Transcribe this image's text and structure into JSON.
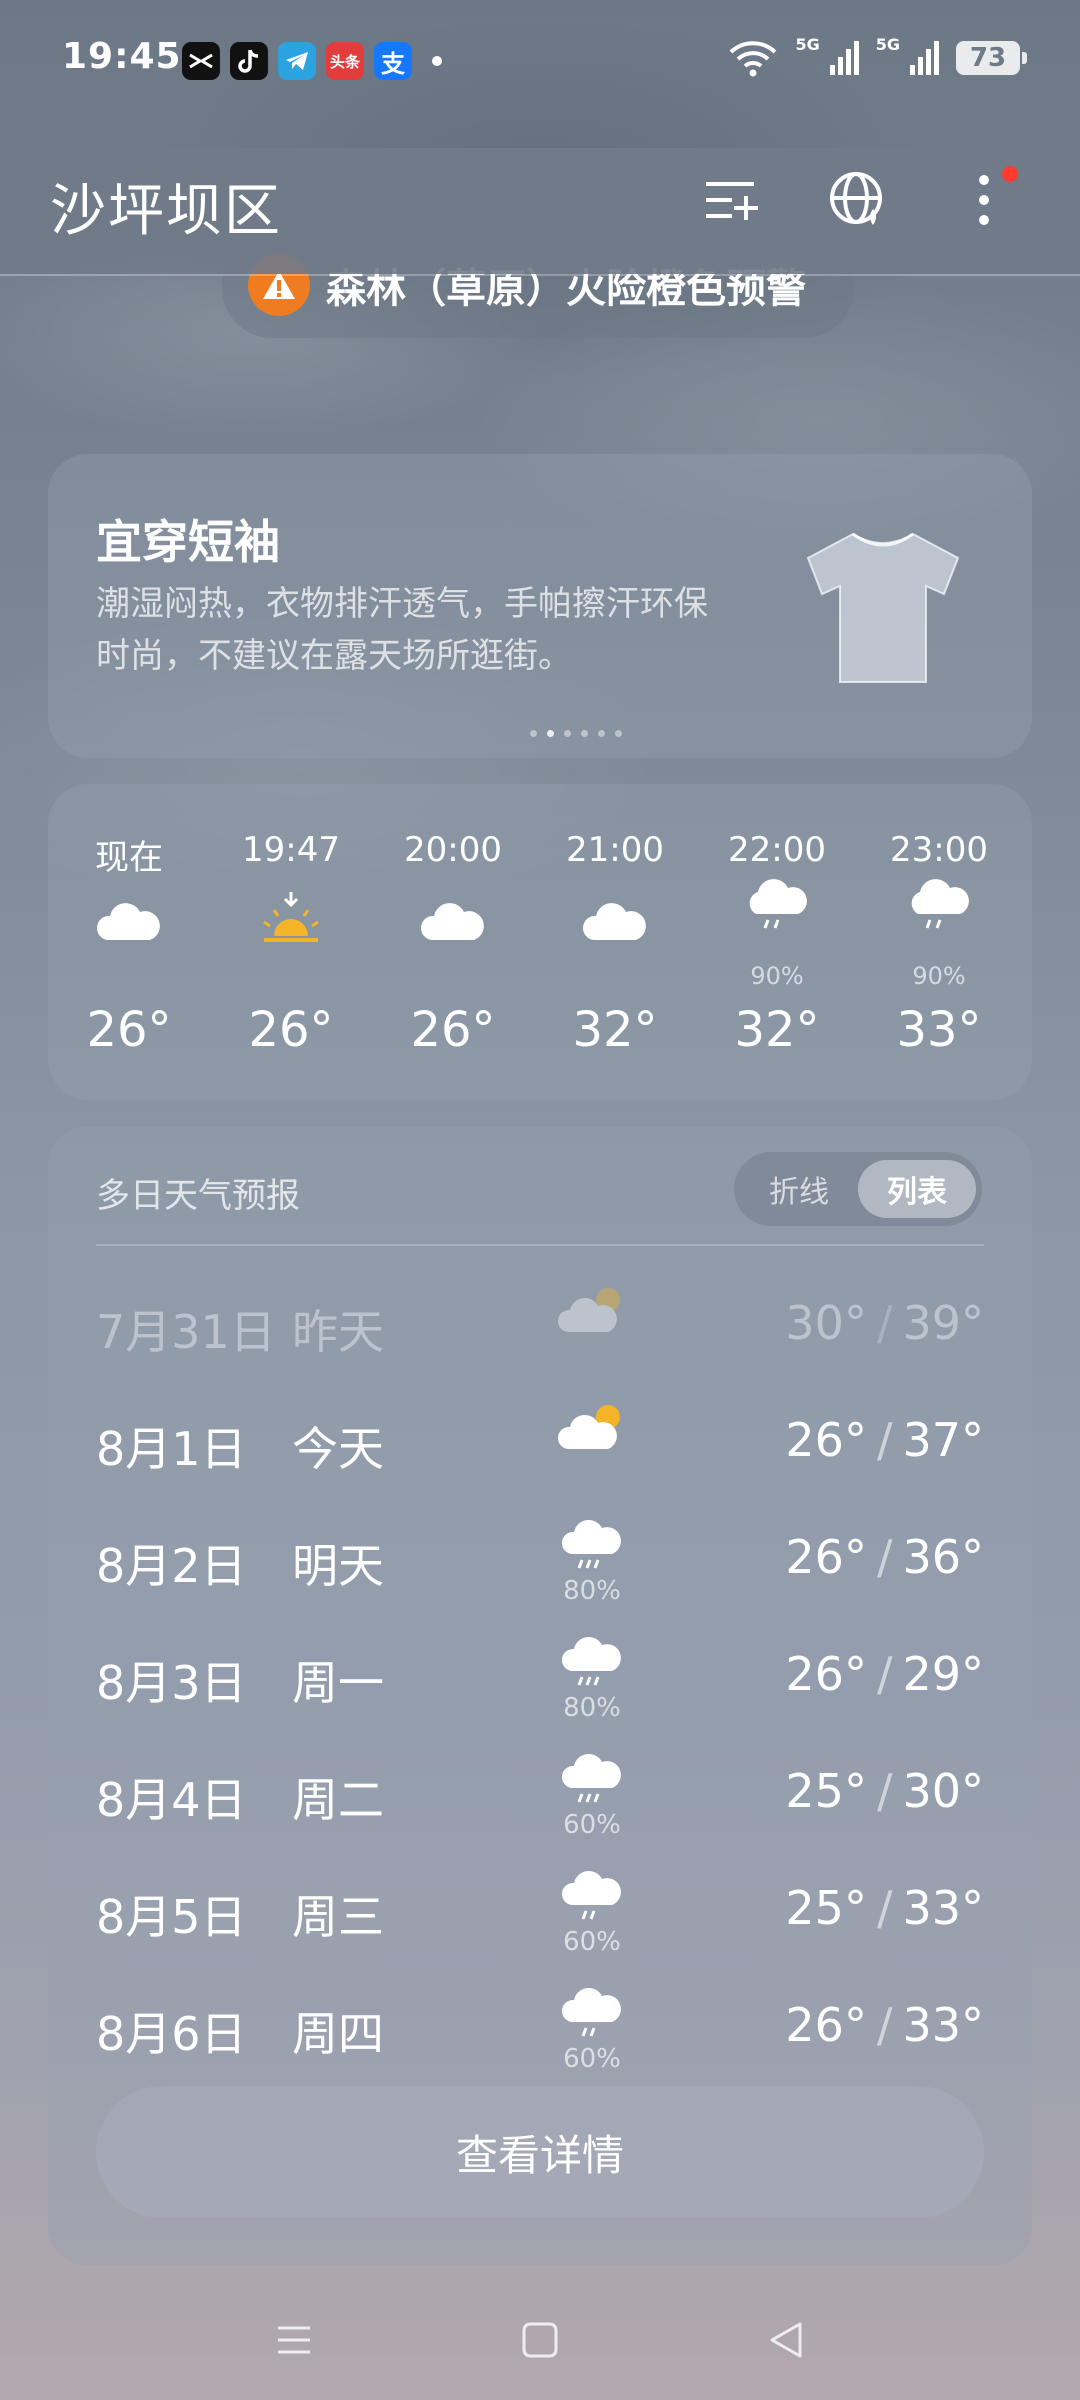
{
  "status_bar": {
    "time": "19:45",
    "apps": [
      {
        "icon": "capcut-icon",
        "label": "",
        "color": "#111111"
      },
      {
        "icon": "tiktok-icon",
        "label": "",
        "color": "#111111"
      },
      {
        "icon": "telegram-icon",
        "label": "",
        "color": "#2aa3e0"
      },
      {
        "icon": "toutiao-icon",
        "label": "头条",
        "color": "#e23c3c"
      },
      {
        "icon": "alipay-icon",
        "label": "支",
        "color": "#1677ff"
      }
    ],
    "network_1": "5G",
    "network_2": "5G",
    "battery": "73"
  },
  "header": {
    "location": "沙坪坝区"
  },
  "alert": {
    "text": "森林（草原）火险橙色预警",
    "color": "#f07c22"
  },
  "clothing": {
    "title": "宜穿短袖",
    "description": "潮湿闷热，衣物排汗透气，手帕擦汗环保时尚，不建议在露天场所逛街。",
    "page_count": 6,
    "active_page": 1
  },
  "hourly": [
    {
      "time": "现在",
      "icon": "cloudy-icon",
      "pop": "",
      "temp": "26°"
    },
    {
      "time": "19:47",
      "icon": "sunset-icon",
      "pop": "",
      "temp": "26°"
    },
    {
      "time": "20:00",
      "icon": "cloudy-icon",
      "pop": "",
      "temp": "26°"
    },
    {
      "time": "21:00",
      "icon": "cloudy-icon",
      "pop": "",
      "temp": "32°"
    },
    {
      "time": "22:00",
      "icon": "rain-icon",
      "pop": "90%",
      "temp": "32°"
    },
    {
      "time": "23:00",
      "icon": "rain-icon",
      "pop": "90%",
      "temp": "33°"
    }
  ],
  "daily": {
    "title": "多日天气预报",
    "toggle": {
      "line": "折线",
      "list": "列表",
      "selected": "列表"
    },
    "rows": [
      {
        "date": "7月31日",
        "day": "昨天",
        "icon": "partly-cloudy-icon",
        "pop": "",
        "low": "30°",
        "high": "39°",
        "past": true
      },
      {
        "date": "8月1日",
        "day": "今天",
        "icon": "partly-cloudy-icon",
        "pop": "",
        "low": "26°",
        "high": "37°",
        "past": false
      },
      {
        "date": "8月2日",
        "day": "明天",
        "icon": "rain-icon",
        "pop": "80%",
        "low": "26°",
        "high": "36°",
        "past": false
      },
      {
        "date": "8月3日",
        "day": "周一",
        "icon": "rain-icon",
        "pop": "80%",
        "low": "26°",
        "high": "29°",
        "past": false
      },
      {
        "date": "8月4日",
        "day": "周二",
        "icon": "rain-icon",
        "pop": "60%",
        "low": "25°",
        "high": "30°",
        "past": false
      },
      {
        "date": "8月5日",
        "day": "周三",
        "icon": "rain-icon",
        "pop": "60%",
        "low": "25°",
        "high": "33°",
        "past": false
      },
      {
        "date": "8月6日",
        "day": "周四",
        "icon": "rain-icon",
        "pop": "60%",
        "low": "26°",
        "high": "33°",
        "past": false
      }
    ],
    "slash": "/",
    "detail_button": "查看详情"
  },
  "colors": {
    "accent_sun": "#f4b428",
    "notification_dot": "#ff3b30"
  }
}
